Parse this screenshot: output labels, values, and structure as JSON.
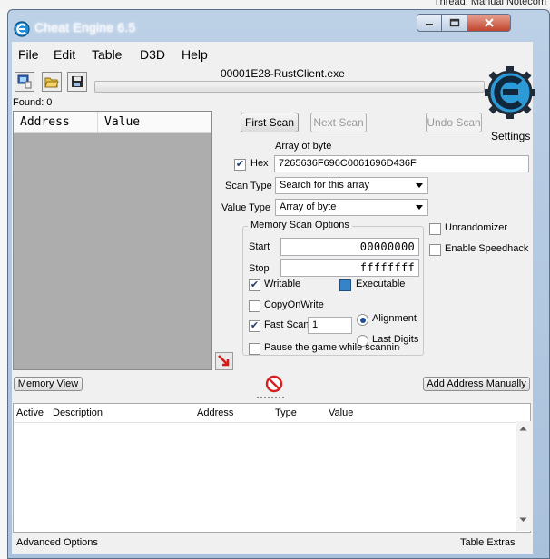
{
  "background": {
    "text": "Thread:  Manual Notecom"
  },
  "window": {
    "title": "Cheat Engine 6.5"
  },
  "menu": [
    "File",
    "Edit",
    "Table",
    "D3D",
    "Help"
  ],
  "process": {
    "title": "00001E28-RustClient.exe"
  },
  "found": {
    "label": "Found: 0"
  },
  "results": {
    "col_address": "Address",
    "col_value": "Value"
  },
  "buttons": {
    "first_scan": "First Scan",
    "next_scan": "Next Scan",
    "undo_scan": "Undo Scan",
    "settings": "Settings",
    "memory_view": "Memory View",
    "add_address": "Add Address Manually"
  },
  "scan": {
    "value_caption": "Array of byte",
    "hex_label": "Hex",
    "hex_checked": true,
    "value": "7265636F696C0061696D436F",
    "scan_type_label": "Scan Type",
    "scan_type": "Search for this array",
    "value_type_label": "Value Type",
    "value_type": "Array of byte"
  },
  "memory_options": {
    "title": "Memory Scan Options",
    "start_label": "Start",
    "start": "00000000",
    "stop_label": "Stop",
    "stop": "ffffffff",
    "writable": "Writable",
    "executable": "Executable",
    "copy_on_write": "CopyOnWrite",
    "fast_scan": "Fast Scan",
    "fast_scan_value": "1",
    "alignment": "Alignment",
    "last_digits": "Last Digits",
    "pause_game": "Pause the game while scanning"
  },
  "side_options": {
    "unrandomizer": "Unrandomizer",
    "speedhack": "Enable Speedhack"
  },
  "address_list": {
    "columns": [
      "Active",
      "Description",
      "Address",
      "Type",
      "Value"
    ]
  },
  "bottom": {
    "advanced": "Advanced Options",
    "extras": "Table Extras"
  },
  "colors": {
    "title_bar": "#aac1dc",
    "close_button": "#c0452d",
    "logo": "#2d9ad8",
    "panel": "#adadad"
  }
}
